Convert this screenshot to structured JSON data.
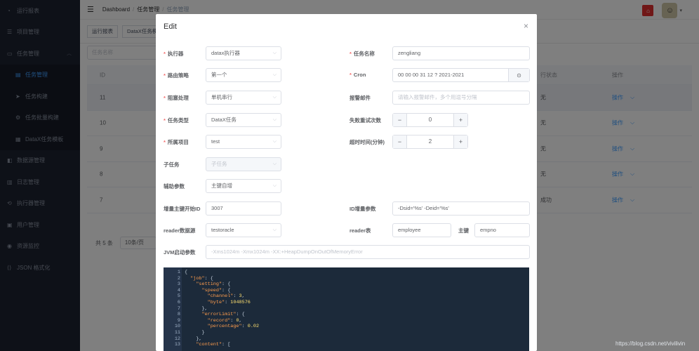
{
  "sidebar": {
    "items": [
      {
        "label": "运行报表",
        "icon": "dashboard-icon"
      },
      {
        "label": "项目管理",
        "icon": "project-icon"
      },
      {
        "label": "任务管理",
        "icon": "monitor-icon",
        "expanded": true
      },
      {
        "label": "任务管理",
        "icon": "list-icon",
        "sub": true,
        "active": true
      },
      {
        "label": "任务构建",
        "icon": "send-icon",
        "sub": true
      },
      {
        "label": "任务批量构建",
        "icon": "gear-icon",
        "sub": true
      },
      {
        "label": "DataX任务模板",
        "icon": "template-icon",
        "sub": true
      },
      {
        "label": "数据源管理",
        "icon": "database-icon"
      },
      {
        "label": "日志管理",
        "icon": "log-icon"
      },
      {
        "label": "执行器管理",
        "icon": "executor-icon"
      },
      {
        "label": "用户管理",
        "icon": "user-icon"
      },
      {
        "label": "资源监控",
        "icon": "monitor-eye-icon"
      },
      {
        "label": "JSON 格式化",
        "icon": "code-icon"
      }
    ]
  },
  "navbar": {
    "breadcrumb": [
      "Dashboard",
      "任务管理",
      "任务管理"
    ]
  },
  "tags": [
    "运行报表",
    "DataX任务模"
  ],
  "background": {
    "filter_placeholder": "任务名称",
    "columns": {
      "id": "ID",
      "status": "行状态",
      "op": "操作"
    },
    "rows": [
      {
        "id": "11",
        "status": "无",
        "op": "操作"
      },
      {
        "id": "10",
        "status": "无",
        "op": "操作"
      },
      {
        "id": "9",
        "status": "无",
        "op": "操作"
      },
      {
        "id": "8",
        "status": "无",
        "op": "操作"
      },
      {
        "id": "7",
        "status": "成功",
        "op": "操作"
      }
    ],
    "pager": {
      "total": "共 5 条",
      "size": "10条/页"
    }
  },
  "dialog": {
    "title": "Edit",
    "labels": {
      "executor": "执行器",
      "task_name": "任务名称",
      "route": "路由策略",
      "cron": "Cron",
      "block": "阻塞处理",
      "alarm_email": "报警邮件",
      "task_type": "任务类型",
      "retry": "失败重试次数",
      "project": "所属项目",
      "timeout": "超时时间(分钟)",
      "child": "子任务",
      "aux": "辅助参数",
      "inc_start": "增量主键开始ID",
      "id_inc_param": "ID增量参数",
      "reader_ds": "reader数据源",
      "reader_table": "reader表",
      "primary_key": "主键",
      "jvm": "JVM启动参数"
    },
    "values": {
      "executor": "datax执行器",
      "task_name": "zengliang",
      "route": "第一个",
      "cron": "00 00 00 31 12 ? 2021-2021",
      "block": "单机串行",
      "alarm_email_placeholder": "请输入报警邮件，多个用逗号分隔",
      "task_type": "DataX任务",
      "retry": "0",
      "project": "test",
      "timeout": "2",
      "child_placeholder": "子任务",
      "aux": "主键自增",
      "inc_start": "3007",
      "id_inc_param": "-Dsid='%s' -Deid='%s'",
      "reader_ds": "testoracle",
      "reader_table": "employee",
      "primary_key": "empno",
      "jvm_placeholder": "-Xms1024m -Xmx1024m -XX:+HeapDumpOnOutOfMemoryError"
    },
    "code_lines": [
      "{",
      "  \"job\": {",
      "    \"setting\": {",
      "      \"speed\": {",
      "        \"channel\": 3,",
      "        \"byte\": 1048576",
      "      },",
      "      \"errorLimit\": {",
      "        \"record\": 0,",
      "        \"percentage\": 0.02",
      "      }",
      "    },",
      "    \"content\": ["
    ]
  },
  "watermark": "https://blog.csdn.net/vivilivin"
}
